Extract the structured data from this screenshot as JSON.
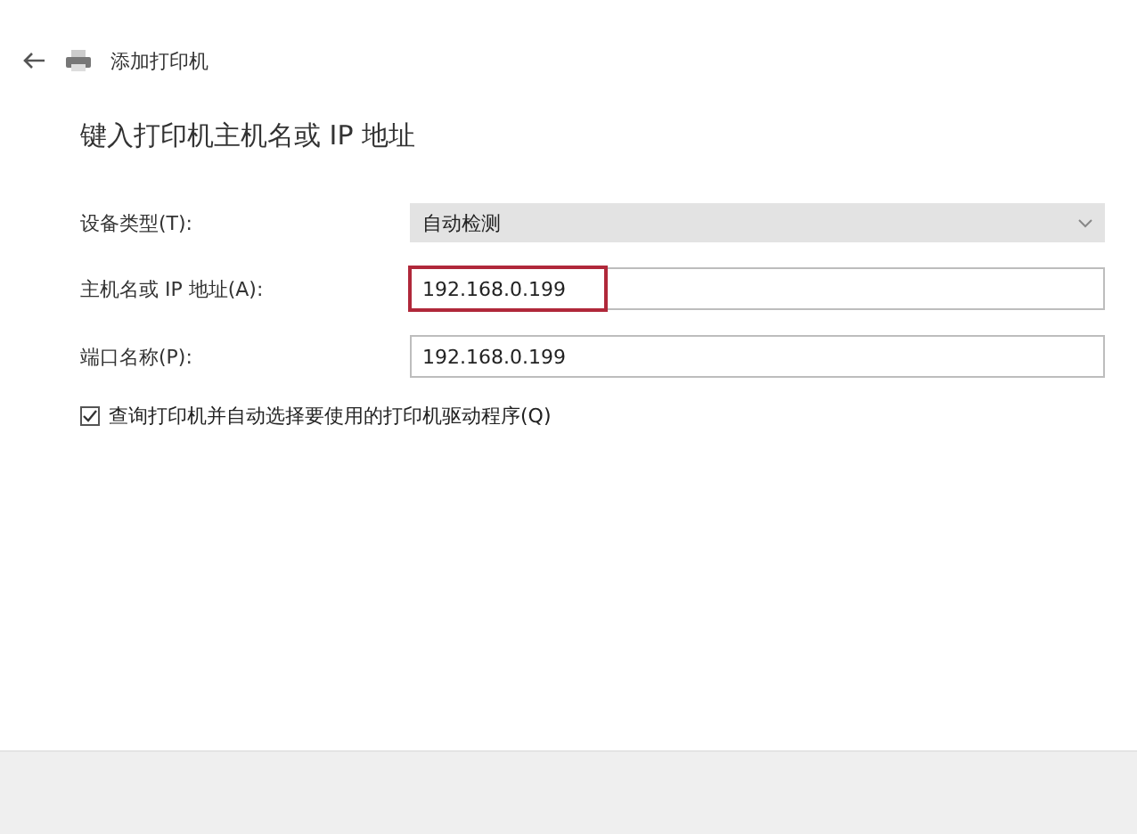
{
  "window": {
    "title": "添加打印机"
  },
  "heading": "键入打印机主机名或 IP 地址",
  "fields": [
    {
      "kind": "dropdown",
      "label": "设备类型(T):",
      "value": "自动检测",
      "highlighted": false
    },
    {
      "kind": "text",
      "label": "主机名或 IP 地址(A):",
      "value": "192.168.0.199",
      "highlighted": true
    },
    {
      "kind": "text",
      "label": "端口名称(P):",
      "value": "192.168.0.199",
      "highlighted": false
    }
  ],
  "checkbox": {
    "label": "查询打印机并自动选择要使用的打印机驱动程序(Q)",
    "checked": true
  }
}
